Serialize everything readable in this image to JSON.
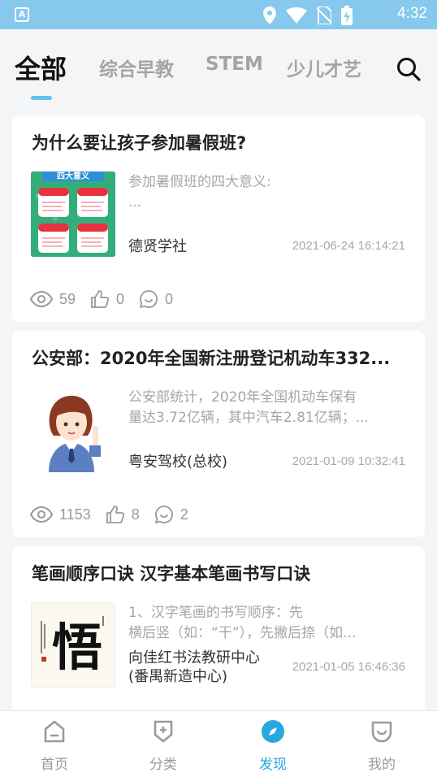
{
  "status_bar": {
    "time": "4:32",
    "app_letter": "A"
  },
  "tabs": [
    {
      "label": "全部",
      "active": true
    },
    {
      "label": "综合早教",
      "active": false
    },
    {
      "label": "STEM",
      "active": false
    },
    {
      "label": "少儿才艺",
      "active": false
    }
  ],
  "cards": [
    {
      "title": "为什么要让孩子参加暑假班?",
      "summary_line1": "参加暑假班的四大意义:",
      "summary_line2": "...",
      "author": "德贤学社",
      "date": "2021-06-24 16:14:21",
      "views": "59",
      "likes": "0",
      "comments": "0",
      "thumb_caption": "四大意义"
    },
    {
      "title": "公安部：2020年全国新注册登记机动车332...",
      "summary_line1": "公安部统计，2020年全国机动车保有",
      "summary_line2": "量达3.72亿辆，其中汽车2.81亿辆；...",
      "author": "粤安驾校(总校)",
      "date": "2021-01-09 10:32:41",
      "views": "1153",
      "likes": "8",
      "comments": "2"
    },
    {
      "title": "笔画顺序口诀 汉字基本笔画书写口诀",
      "summary_line1": "1、汉字笔画的书写顺序：先",
      "summary_line2": "横后竖（如：“干”），先撇后捺（如...",
      "author_line1": "向佳红书法教研中心",
      "author_line2": "(番禺新造中心)",
      "date": "2021-01-05 16:46:36",
      "thumb_char": "悟"
    }
  ],
  "bottom_nav": [
    {
      "label": "首页",
      "icon": "home-icon"
    },
    {
      "label": "分类",
      "icon": "category-icon"
    },
    {
      "label": "发现",
      "icon": "compass-icon",
      "active": true
    },
    {
      "label": "我的",
      "icon": "profile-icon"
    }
  ],
  "colors": {
    "accent": "#2aa6e0",
    "status_bar": "#86c9ec",
    "indicator": "#5ec4ee"
  }
}
